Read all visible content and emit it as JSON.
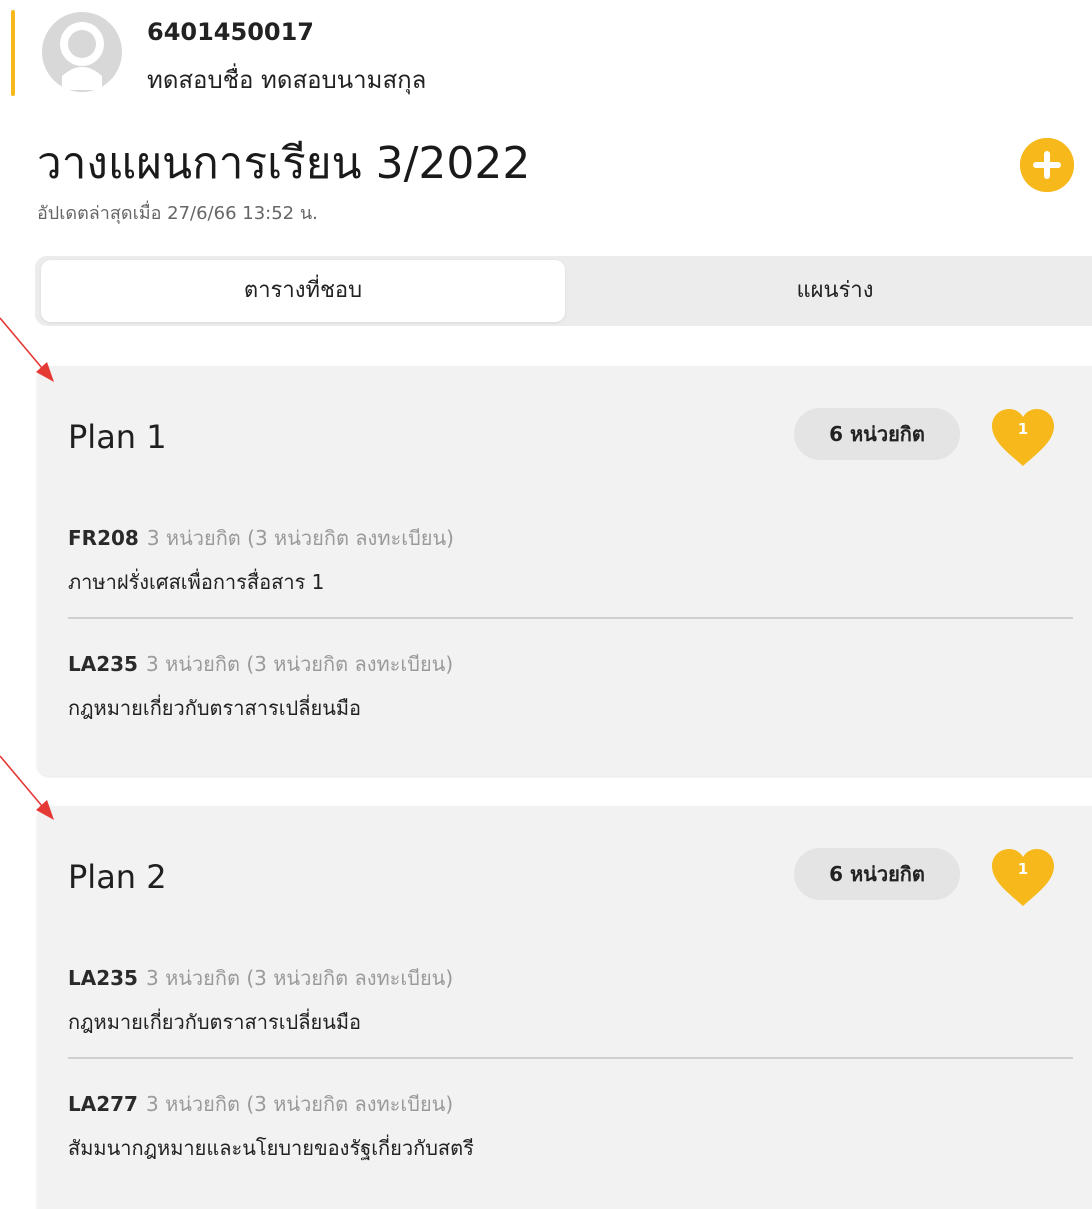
{
  "profile": {
    "student_id": "6401450017",
    "student_name": "ทดสอบชื่อ ทดสอบนามสกุล",
    "avatar_icon": "user-avatar-placeholder-icon"
  },
  "header": {
    "title": "วางแผนการเรียน 3/2022",
    "updated_at": "อัปเดตล่าสุดเมื่อ 27/6/66 13:52 น.",
    "add_icon": "plus-circle-icon"
  },
  "tabs": [
    {
      "label": "ตารางที่ชอบ",
      "active": true
    },
    {
      "label": "แผนร่าง",
      "active": false
    }
  ],
  "plans": [
    {
      "title": "Plan 1",
      "credits_badge": "6 หน่วยกิต",
      "like_count": "1",
      "courses": [
        {
          "code": "FR208",
          "credits": "3 หน่วยกิต (3 หน่วยกิต ลงทะเบียน)",
          "name": "ภาษาฝรั่งเศสเพื่อการสื่อสาร 1"
        },
        {
          "code": "LA235",
          "credits": "3 หน่วยกิต (3 หน่วยกิต ลงทะเบียน)",
          "name": "กฎหมายเกี่ยวกับตราสารเปลี่ยนมือ"
        }
      ]
    },
    {
      "title": "Plan 2",
      "credits_badge": "6 หน่วยกิต",
      "like_count": "1",
      "courses": [
        {
          "code": "LA235",
          "credits": "3 หน่วยกิต (3 หน่วยกิต ลงทะเบียน)",
          "name": "กฎหมายเกี่ยวกับตราสารเปลี่ยนมือ"
        },
        {
          "code": "LA277",
          "credits": "3 หน่วยกิต (3 หน่วยกิต ลงทะเบียน)",
          "name": "สัมมนากฎหมายและนโยบายของรัฐเกี่ยวกับสตรี"
        }
      ]
    }
  ],
  "colors": {
    "accent": "#f6b81a",
    "annotation_arrow": "#e53935",
    "card_background": "#f2f2f2"
  }
}
